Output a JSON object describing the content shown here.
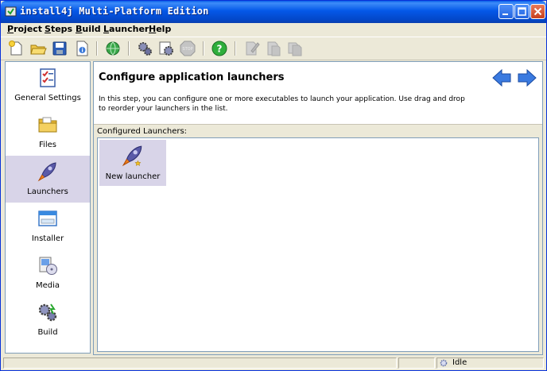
{
  "window": {
    "title": "install4j Multi-Platform Edition",
    "accent_color": "#0458e8"
  },
  "menu": [
    {
      "label": "Project",
      "mnemonic": "P"
    },
    {
      "label": "Steps",
      "mnemonic": "S"
    },
    {
      "label": "Build",
      "mnemonic": "B"
    },
    {
      "label": "Launcher",
      "mnemonic": "L"
    },
    {
      "label": "Help",
      "mnemonic": "H"
    }
  ],
  "toolbar": {
    "buttons": [
      "new-project-icon",
      "open-project-icon",
      "save-project-icon",
      "project-info-icon",
      "web-icon",
      "settings-gear-icon",
      "build-gears-icon",
      "stop-icon",
      "help-icon",
      "edit-doc-icon",
      "copy-doc-icon",
      "paste-doc-icon"
    ]
  },
  "sidebar": {
    "items": [
      {
        "label": "General Settings",
        "icon": "checklist-icon",
        "selected": false
      },
      {
        "label": "Files",
        "icon": "folder-icon",
        "selected": false
      },
      {
        "label": "Launchers",
        "icon": "rocket-icon",
        "selected": true
      },
      {
        "label": "Installer",
        "icon": "window-icon",
        "selected": false
      },
      {
        "label": "Media",
        "icon": "media-icon",
        "selected": false
      },
      {
        "label": "Build",
        "icon": "gears-icon",
        "selected": false
      }
    ]
  },
  "main": {
    "title": "Configure application launchers",
    "description": "In this step, you can configure one or more executables to launch your application. Use drag and drop to reorder your launchers in the list.",
    "section_label": "Configured Launchers:",
    "launchers": [
      {
        "label": "New launcher",
        "icon": "rocket-icon"
      }
    ]
  },
  "status": {
    "text": "Idle"
  }
}
